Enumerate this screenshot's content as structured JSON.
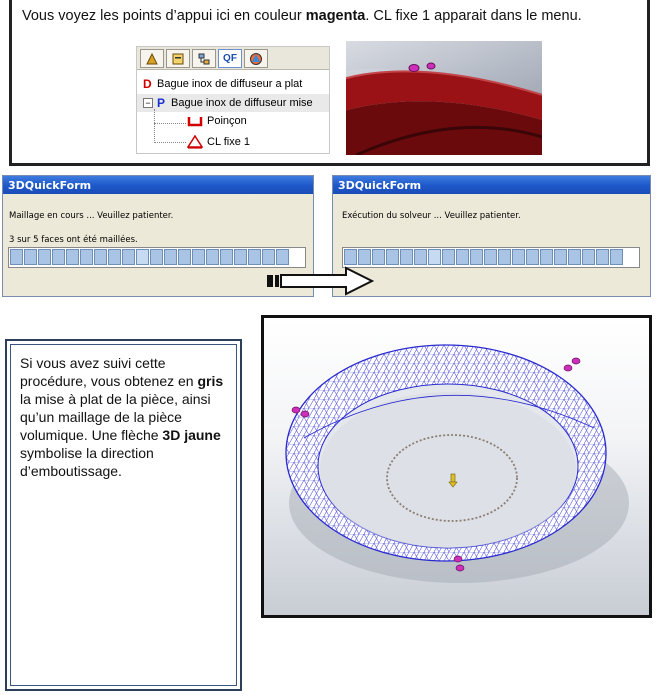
{
  "top_caption": {
    "prefix": "Vous voyez les points d’appui ici en couleur ",
    "bold": "magenta",
    "suffix": ". CL fixe 1 apparait dans le menu."
  },
  "tree": {
    "toolbar_active": "QF",
    "items": [
      {
        "prefix": "D",
        "label": "Bague inox de diffuseur a plat"
      },
      {
        "prefix": "P",
        "label": "Bague inox de diffuseur  mise"
      },
      {
        "label": "Poinçon"
      },
      {
        "label": "CL fixe 1"
      }
    ]
  },
  "dialog_left": {
    "title": "3DQuickForm",
    "status": "Maillage en cours ... Veuillez patienter.",
    "progress_text": "3 sur 5 faces ont été maillées.",
    "progress_fraction": 0.6
  },
  "dialog_right": {
    "title": "3DQuickForm",
    "status": "Exécution du solveur ...  Veuillez patienter.",
    "progress_fraction": 0.3
  },
  "description": {
    "part1": "Si vous avez suivi cette procédure, vous obtenez en ",
    "bold1": "gris",
    "part2": " la mise à plat de la pièce, ainsi qu’un maillage de la pièce volumique. Une flèche ",
    "bold2": "3D jaune",
    "part3": " symbolise la direction d’emboutissage."
  },
  "colors": {
    "magenta": "#cc2fb8",
    "mesh_blue": "#2a2ad0",
    "ring_red": "#8b0f12"
  }
}
